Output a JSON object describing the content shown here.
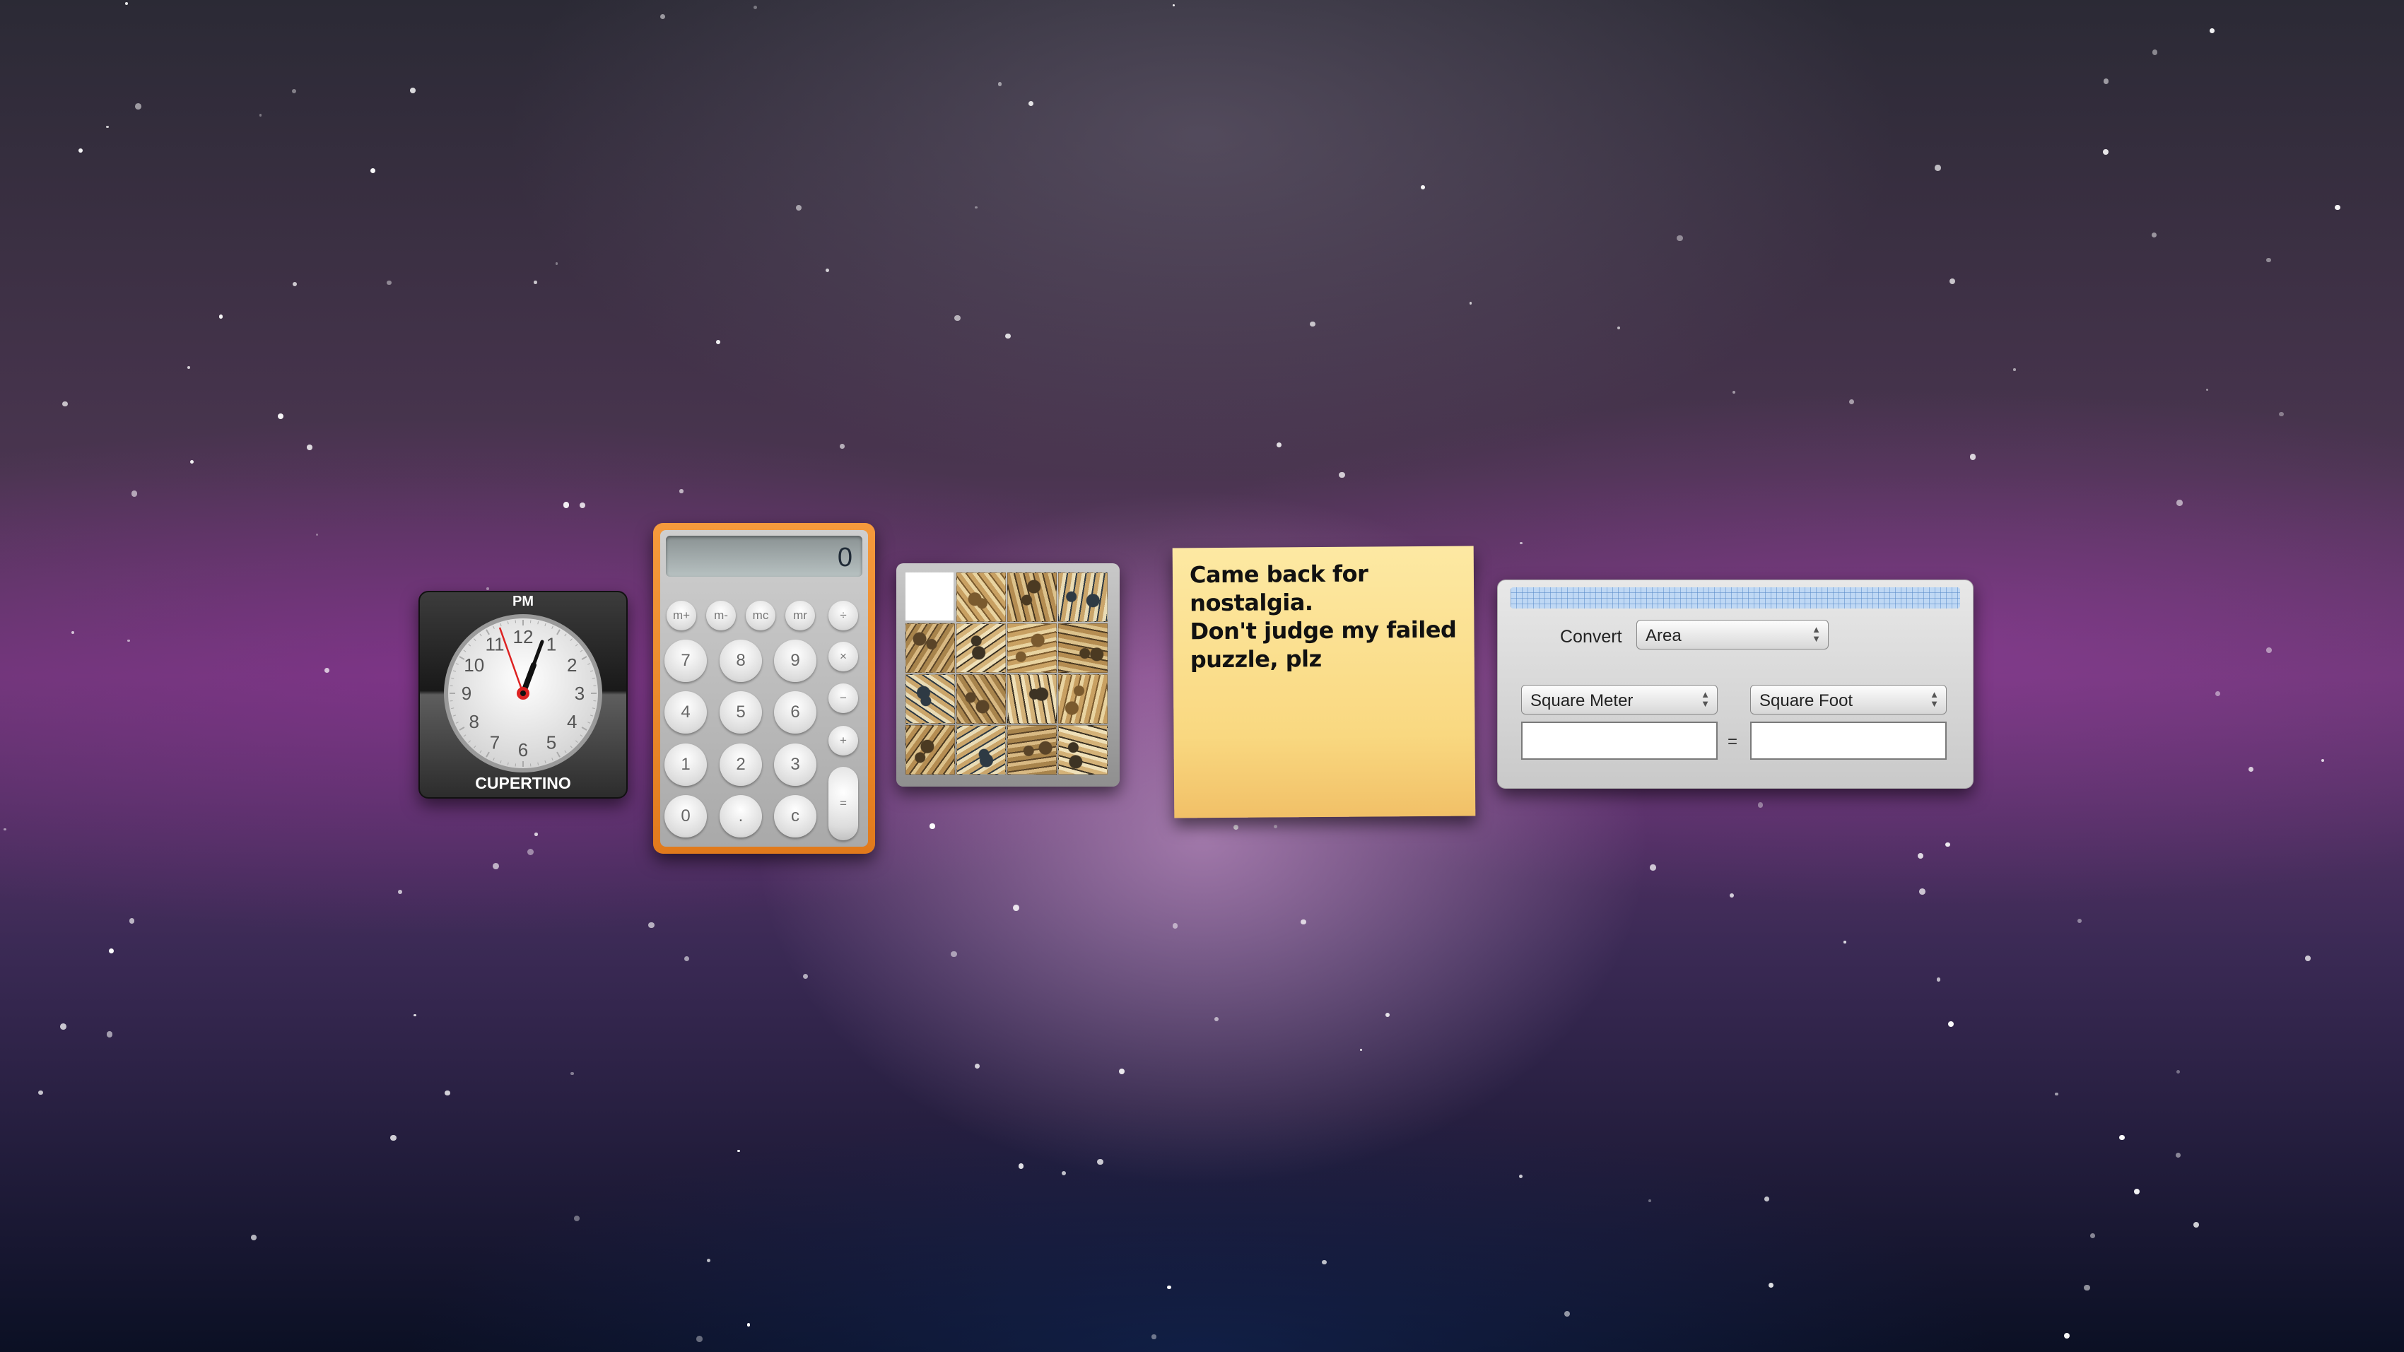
{
  "clock": {
    "ampm": "PM",
    "city": "CUPERTINO",
    "numbers": [
      "12",
      "1",
      "2",
      "3",
      "4",
      "5",
      "6",
      "7",
      "8",
      "9",
      "10",
      "11"
    ]
  },
  "calculator": {
    "display": "0",
    "memory_buttons": [
      "m+",
      "m-",
      "mc",
      "mr"
    ],
    "ops": {
      "divide": "÷",
      "multiply": "×",
      "minus": "−",
      "plus": "+",
      "equals": "="
    },
    "digits": [
      "7",
      "8",
      "9",
      "4",
      "5",
      "6",
      "1",
      "2",
      "3",
      "0",
      ".",
      "c"
    ]
  },
  "sticky_note": {
    "line1": "Came back for nostalgia.",
    "line2": "Don't judge my failed",
    "line3": "puzzle, plz"
  },
  "converter": {
    "convert_label": "Convert",
    "category": "Area",
    "from_unit": "Square Meter",
    "to_unit": "Square Foot",
    "equals": "=",
    "from_value": "",
    "to_value": ""
  },
  "colors": {
    "calculator_frame": "#f08a2c",
    "sticky_note": "#f9d880"
  }
}
